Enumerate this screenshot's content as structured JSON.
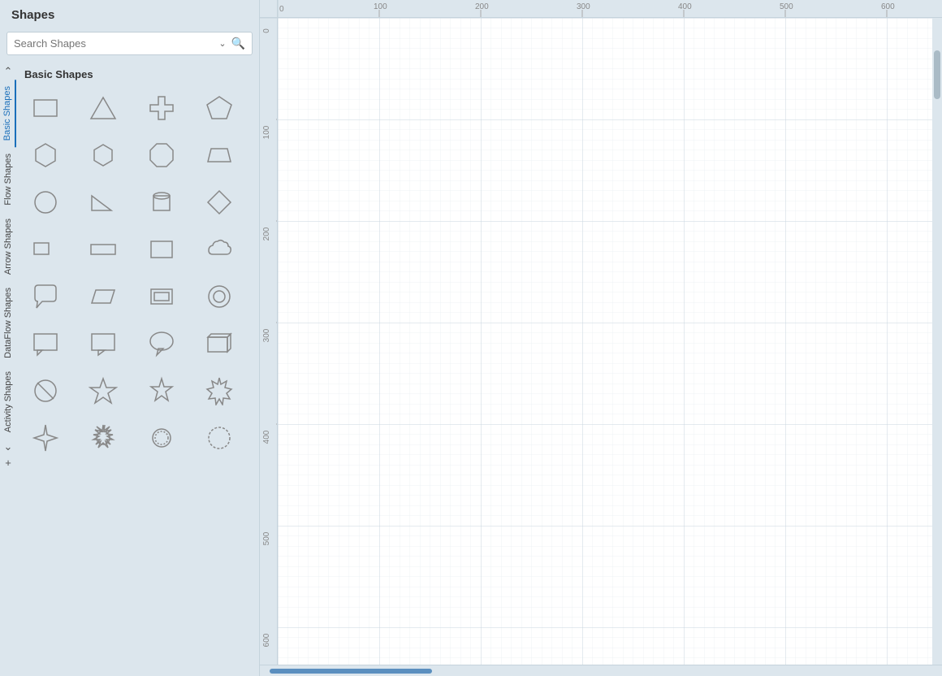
{
  "panel": {
    "title": "Shapes",
    "search_placeholder": "Search Shapes"
  },
  "vertical_tabs": [
    {
      "label": "Basic Shapes",
      "active": true
    },
    {
      "label": "Flow Shapes",
      "active": false
    },
    {
      "label": "Arrow Shapes",
      "active": false
    },
    {
      "label": "DataFlow Shapes",
      "active": false
    },
    {
      "label": "Activity Shapes",
      "active": false
    }
  ],
  "section": {
    "title": "Basic Shapes"
  },
  "ruler": {
    "top_marks": [
      0,
      100,
      200,
      300,
      400,
      500,
      600
    ],
    "left_marks": [
      0,
      100,
      200,
      300,
      400,
      500,
      600
    ]
  },
  "icons": {
    "chevron_down": "⌄",
    "search": "🔍",
    "chevron_up": "^",
    "add": "+"
  }
}
